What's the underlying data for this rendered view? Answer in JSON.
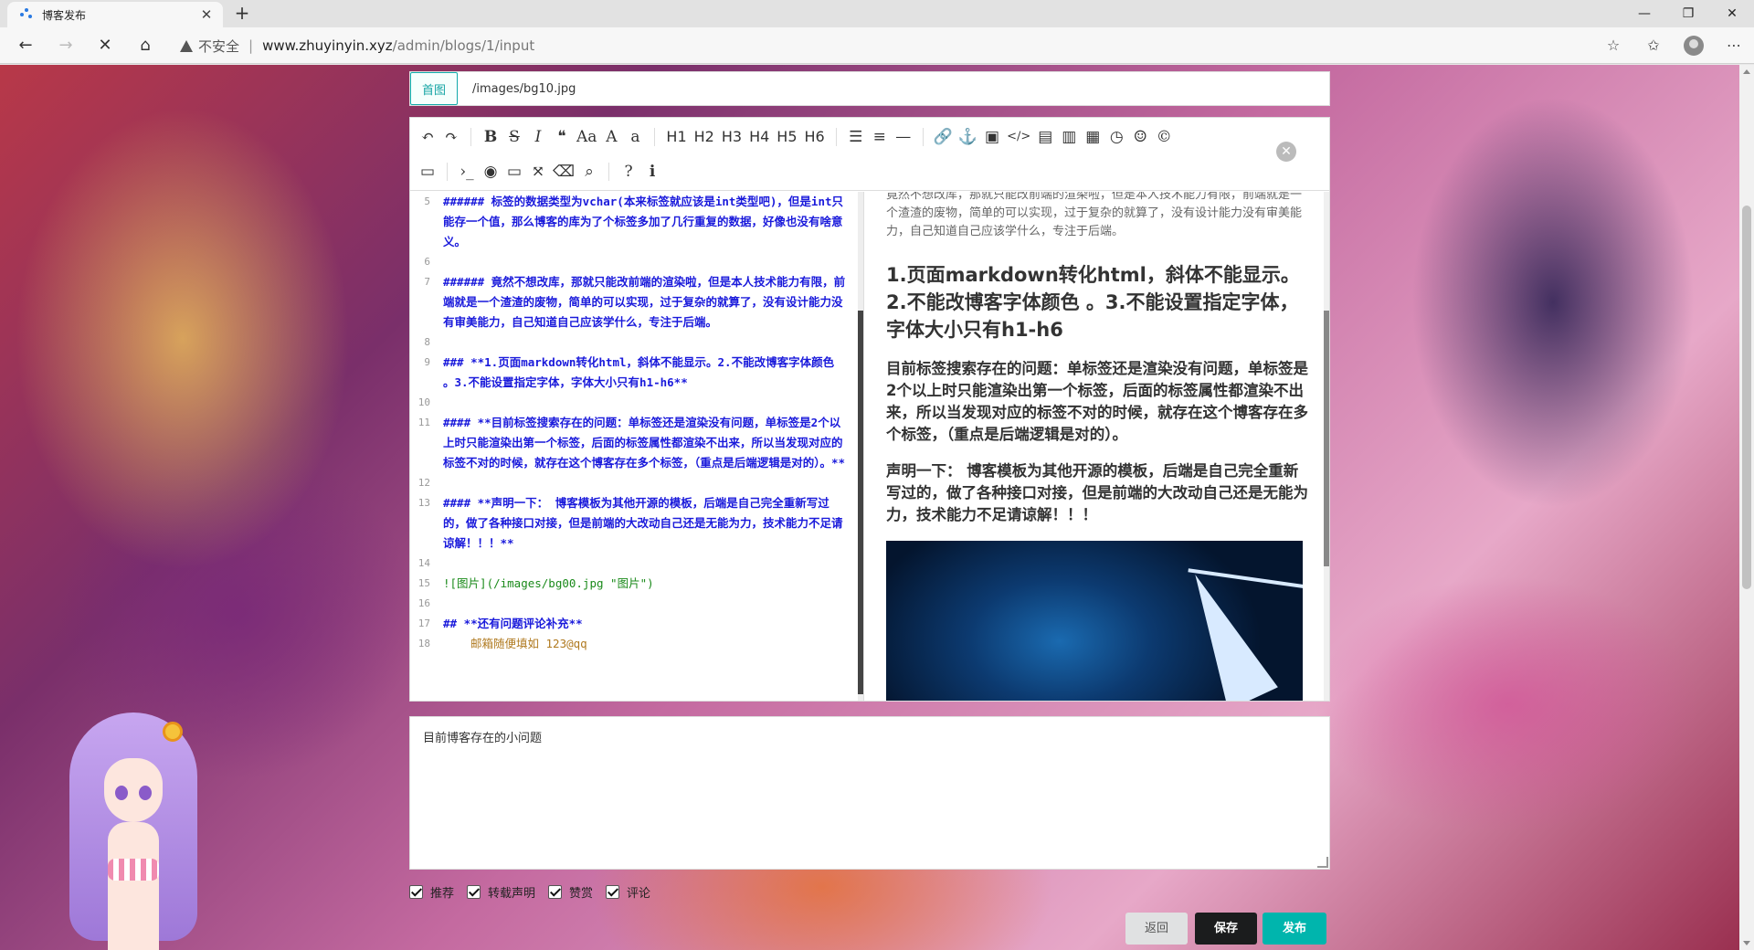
{
  "browser": {
    "tab_title": "博客发布",
    "url_warning": "不安全",
    "url_host": "www.zhuyinyin.xyz",
    "url_path": "/admin/blogs/1/input"
  },
  "cover": {
    "label": "首图",
    "value": "/images/bg10.jpg"
  },
  "toolbar": {
    "row1": [
      "undo-icon",
      "redo-icon",
      "|",
      "bold-icon",
      "strikethrough-icon",
      "italic-icon",
      "quote-icon",
      "uppercase-icon",
      "uppercase-first-icon",
      "lowercase-icon",
      "|",
      "H1",
      "H2",
      "H3",
      "H4",
      "H5",
      "H6",
      "|",
      "list-ul-icon",
      "list-ol-icon",
      "hr-icon",
      "|",
      "link-icon",
      "anchor-icon",
      "image-icon",
      "code-icon",
      "preformatted-code-icon",
      "code-block-icon",
      "table-icon",
      "datetime-icon",
      "emoji-icon",
      "html-entities-icon"
    ],
    "row2": [
      "page-break-icon",
      "|",
      "goto-line-icon",
      "watch-icon",
      "preview-icon",
      "fullscreen-icon",
      "clear-icon",
      "search-icon",
      "|",
      "help-icon",
      "info-icon"
    ],
    "headings": [
      "H1",
      "H2",
      "H3",
      "H4",
      "H5",
      "H6"
    ]
  },
  "code_lines": [
    {
      "n": "5",
      "text": "###### 标签的数据类型为vchar(本来标签就应该是int类型吧)，但是int只能存一个值，那么博客的库为了个标签多加了几行重复的数据，好像也没有啥意义。",
      "kind": "md"
    },
    {
      "n": "6",
      "text": "",
      "kind": "md"
    },
    {
      "n": "7",
      "text": "###### 竟然不想改库，那就只能改前端的渲染啦，但是本人技术能力有限，前端就是一个渣渣的废物，简单的可以实现，过于复杂的就算了，没有设计能力没有审美能力，自己知道自己应该学什么，专注于后端。",
      "kind": "md"
    },
    {
      "n": "8",
      "text": "",
      "kind": "md"
    },
    {
      "n": "9",
      "text": "### **1.页面markdown转化html，斜体不能显示。2.不能改博客字体颜色 。3.不能设置指定字体，字体大小只有h1-h6**",
      "kind": "md"
    },
    {
      "n": "10",
      "text": "",
      "kind": "md"
    },
    {
      "n": "11",
      "text": "#### **目前标签搜索存在的问题：单标签还是渲染没有问题，单标签是2个以上时只能渲染出第一个标签，后面的标签属性都渲染不出来，所以当发现对应的标签不对的时候，就存在这个博客存在多个标签，（重点是后端逻辑是对的）。**",
      "kind": "md"
    },
    {
      "n": "12",
      "text": "",
      "kind": "md"
    },
    {
      "n": "13",
      "text": "#### **声明一下： 博客模板为其他开源的模板，后端是自己完全重新写过的，做了各种接口对接，但是前端的大改动自己还是无能为力，技术能力不足请谅解！！！**",
      "kind": "md"
    },
    {
      "n": "14",
      "text": "",
      "kind": "md"
    },
    {
      "n": "15",
      "text": "![图片](/images/bg00.jpg \"图片\")",
      "kind": "img"
    },
    {
      "n": "16",
      "text": "",
      "kind": "md"
    },
    {
      "n": "17",
      "text": "## **还有问题评论补充**",
      "kind": "md"
    },
    {
      "n": "18",
      "text": "邮箱随便填如 123@qq",
      "kind": "mail"
    }
  ],
  "preview": {
    "faded_paragraph": "竟然不想改库，那就只能改前端的渲染啦，但是本人技术能力有限，前端就是一个渣渣的废物，简单的可以实现，过于复杂的就算了，没有设计能力没有审美能力，自己知道自己应该学什么，专注于后端。",
    "h3": "1.页面markdown转化html，斜体不能显示。2.不能改博客字体颜色 。3.不能设置指定字体，字体大小只有h1-h6",
    "h4_a": "目前标签搜索存在的问题：单标签还是渲染没有问题，单标签是2个以上时只能渲染出第一个标签，后面的标签属性都渲染不出来，所以当发现对应的标签不对的时候，就存在这个博客存在多个标签，（重点是后端逻辑是对的）。",
    "h4_b": "声明一下： 博客模板为其他开源的模板，后端是自己完全重新写过的，做了各种接口对接，但是前端的大改动自己还是无能为力，技术能力不足请谅解！！！"
  },
  "description": {
    "value": "目前博客存在的小问题"
  },
  "checkboxes": [
    {
      "label": "推荐",
      "checked": true
    },
    {
      "label": "转载声明",
      "checked": true
    },
    {
      "label": "赞赏",
      "checked": true
    },
    {
      "label": "评论",
      "checked": true
    }
  ],
  "buttons": {
    "back": "返回",
    "save": "保存",
    "publish": "发布"
  },
  "colors": {
    "publish": "#00b5ad",
    "save": "#1b1c1d",
    "markdown_text": "#1a1adb"
  }
}
